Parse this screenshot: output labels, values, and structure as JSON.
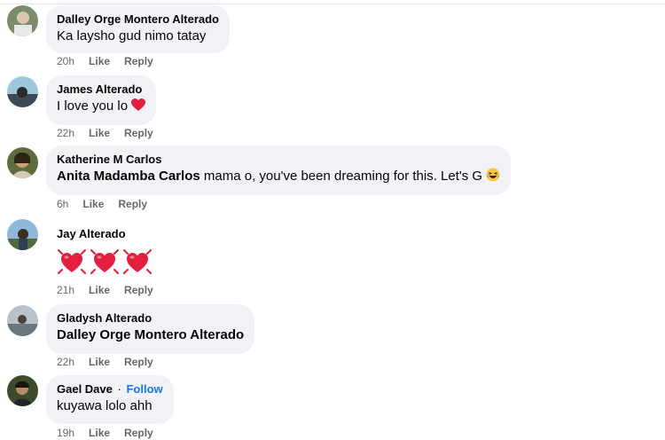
{
  "comments": [
    {
      "author": "Dalley Orge Montero Alterado",
      "text": "Ka laysho gud nimo tatay",
      "time": "20h",
      "like": "Like",
      "reply": "Reply"
    },
    {
      "author": "James Alterado",
      "text": "I love you lo",
      "emoji": "red-heart",
      "time": "22h",
      "like": "Like",
      "reply": "Reply"
    },
    {
      "author": "Katherine M Carlos",
      "mention": "Anita Madamba Carlos",
      "text": " mama o, you've been dreaming for this. Let's G",
      "emoji": "laughing-face",
      "time": "6h",
      "like": "Like",
      "reply": "Reply"
    },
    {
      "author": "Jay Alterado",
      "emoji": "three-beating-hearts",
      "time": "21h",
      "like": "Like",
      "reply": "Reply"
    },
    {
      "author": "Gladysh Alterado",
      "mention": "Dalley Orge Montero Alterado",
      "time": "22h",
      "like": "Like",
      "reply": "Reply"
    },
    {
      "author": "Gael Dave",
      "separator": "·",
      "follow": "Follow",
      "text": "kuyawa lolo ahh",
      "time": "19h",
      "like": "Like",
      "reply": "Reply"
    }
  ],
  "colors": {
    "bubble": "#f0f2f5",
    "meta": "#65676b",
    "follow": "#1877f2",
    "heart": "#e41e3f"
  }
}
